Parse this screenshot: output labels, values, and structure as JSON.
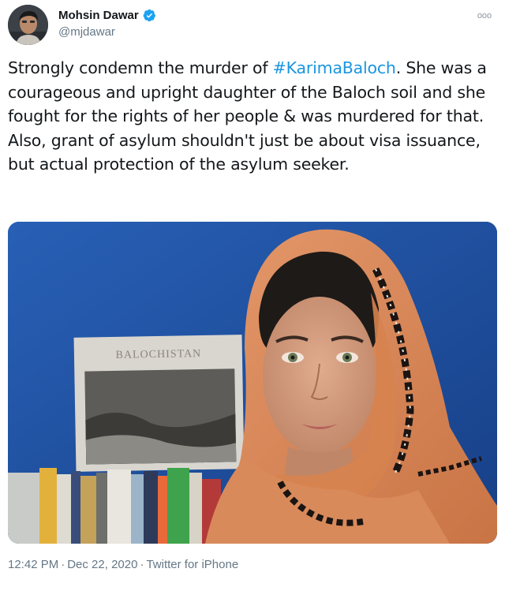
{
  "user": {
    "display_name": "Mohsin Dawar",
    "handle": "@mjdawar",
    "verified": true
  },
  "menu": {
    "icon": "more-options-icon",
    "glyph": "ooo"
  },
  "tweet": {
    "text_before": "Strongly condemn the murder of ",
    "hashtag": "#KarimaBaloch",
    "text_after": ". She was a courageous and upright daughter of the Baloch soil and she fought for the rights of her people & was murdered for that. Also, grant of asylum shouldn't just be about visa issuance, but actual protection of the asylum seeker."
  },
  "media": {
    "book_title": "BALOCHISTAN"
  },
  "meta": {
    "time": "12:42 PM",
    "date": "Dec 22, 2020",
    "separator": "·",
    "source": "Twitter for iPhone"
  },
  "colors": {
    "link": "#1b95e0",
    "secondary_text": "#657786",
    "verified_badge": "#1da1f2",
    "photo_background": "#1e55a8",
    "scarf": "#d98a5a"
  }
}
